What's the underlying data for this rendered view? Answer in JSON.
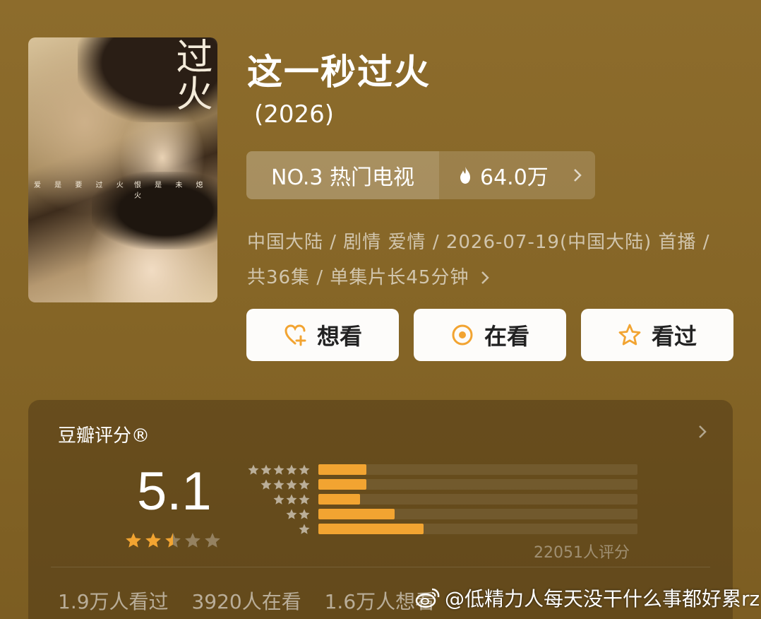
{
  "poster": {
    "title_art": "过火",
    "subtitle_left": "爱 是 要 过 火",
    "subtitle_right": "恨 是 未 熄 火"
  },
  "title": "这一秒过火",
  "year": "(2026)",
  "rank": {
    "label": "NO.3 热门电视",
    "heat": "64.0万",
    "icon": "fire-icon"
  },
  "meta": {
    "line1": "中国大陆 / 剧情 爱情 / 2026-07-19(中国大陆) 首播 /",
    "line2": "共36集 / 单集片长45分钟"
  },
  "buttons": {
    "want": "想看",
    "watching": "在看",
    "watched": "看过"
  },
  "rating": {
    "title": "豆瓣评分®",
    "score": "5.1",
    "stars": 2.5,
    "distribution": [
      {
        "stars": 5,
        "percent": 15
      },
      {
        "stars": 4,
        "percent": 15
      },
      {
        "stars": 3,
        "percent": 13
      },
      {
        "stars": 2,
        "percent": 24
      },
      {
        "stars": 1,
        "percent": 33
      }
    ],
    "count": "22051人评分",
    "accent": "#f2a431"
  },
  "stats": {
    "watched": "1.9万人看过",
    "watching": "3920人在看",
    "want": "1.6万人想看"
  },
  "watermark": "@低精力人每天没干什么事都好累rz"
}
